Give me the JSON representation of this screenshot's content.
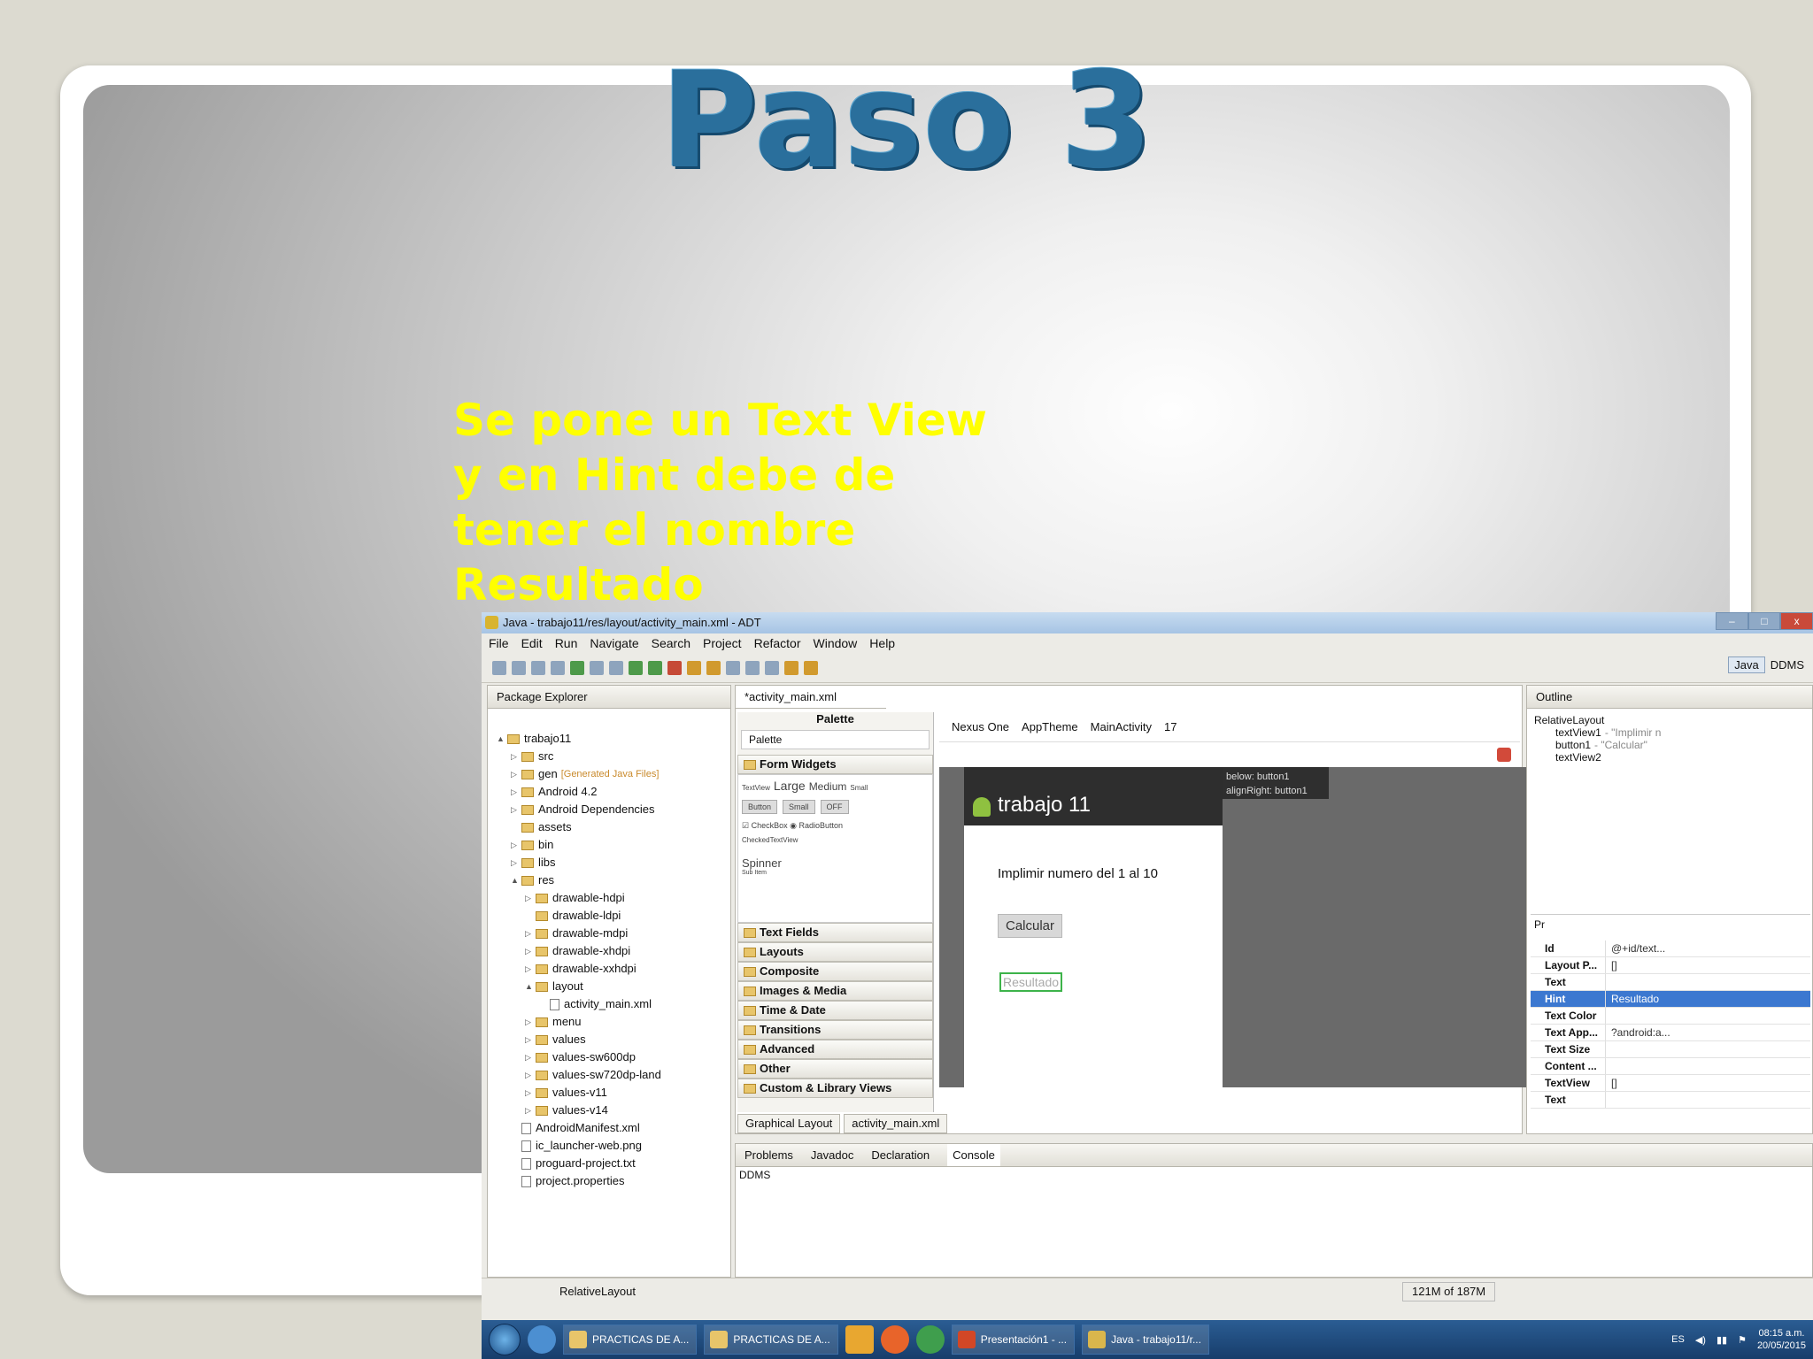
{
  "slide": {
    "title": "Paso 3",
    "body_lines": [
      "Se pone un Text View",
      "y en Hint debe de",
      "tener el nombre",
      "Resultado"
    ]
  },
  "window": {
    "title": "Java - trabajo11/res/layout/activity_main.xml - ADT",
    "minimize": "–",
    "maximize": "□",
    "close": "x"
  },
  "menu": [
    "File",
    "Edit",
    "Run",
    "Navigate",
    "Search",
    "Project",
    "Refactor",
    "Window",
    "Help"
  ],
  "perspectives": {
    "java": "Java",
    "ddms": "DDMS"
  },
  "package_explorer": {
    "tab": "Package Explorer",
    "tree": [
      {
        "label": "trabajo11",
        "depth": 0,
        "twisty": "▲",
        "icon": "project"
      },
      {
        "label": "src",
        "depth": 1,
        "twisty": "▷",
        "icon": "folder"
      },
      {
        "label": "gen",
        "note": "[Generated Java Files]",
        "depth": 1,
        "twisty": "▷",
        "icon": "folder"
      },
      {
        "label": "Android 4.2",
        "depth": 1,
        "twisty": "▷",
        "icon": "library"
      },
      {
        "label": "Android Dependencies",
        "depth": 1,
        "twisty": "▷",
        "icon": "library"
      },
      {
        "label": "assets",
        "depth": 1,
        "twisty": "",
        "icon": "folder"
      },
      {
        "label": "bin",
        "depth": 1,
        "twisty": "▷",
        "icon": "folder"
      },
      {
        "label": "libs",
        "depth": 1,
        "twisty": "▷",
        "icon": "folder"
      },
      {
        "label": "res",
        "depth": 1,
        "twisty": "▲",
        "icon": "folder"
      },
      {
        "label": "drawable-hdpi",
        "depth": 2,
        "twisty": "▷",
        "icon": "folder"
      },
      {
        "label": "drawable-ldpi",
        "depth": 2,
        "twisty": "",
        "icon": "folder"
      },
      {
        "label": "drawable-mdpi",
        "depth": 2,
        "twisty": "▷",
        "icon": "folder"
      },
      {
        "label": "drawable-xhdpi",
        "depth": 2,
        "twisty": "▷",
        "icon": "folder"
      },
      {
        "label": "drawable-xxhdpi",
        "depth": 2,
        "twisty": "▷",
        "icon": "folder"
      },
      {
        "label": "layout",
        "depth": 2,
        "twisty": "▲",
        "icon": "folder"
      },
      {
        "label": "activity_main.xml",
        "depth": 3,
        "twisty": "",
        "icon": "file"
      },
      {
        "label": "menu",
        "depth": 2,
        "twisty": "▷",
        "icon": "folder"
      },
      {
        "label": "values",
        "depth": 2,
        "twisty": "▷",
        "icon": "folder"
      },
      {
        "label": "values-sw600dp",
        "depth": 2,
        "twisty": "▷",
        "icon": "folder"
      },
      {
        "label": "values-sw720dp-land",
        "depth": 2,
        "twisty": "▷",
        "icon": "folder"
      },
      {
        "label": "values-v11",
        "depth": 2,
        "twisty": "▷",
        "icon": "folder"
      },
      {
        "label": "values-v14",
        "depth": 2,
        "twisty": "▷",
        "icon": "folder"
      },
      {
        "label": "AndroidManifest.xml",
        "depth": 1,
        "twisty": "",
        "icon": "file"
      },
      {
        "label": "ic_launcher-web.png",
        "depth": 1,
        "twisty": "",
        "icon": "file"
      },
      {
        "label": "proguard-project.txt",
        "depth": 1,
        "twisty": "",
        "icon": "file"
      },
      {
        "label": "project.properties",
        "depth": 1,
        "twisty": "",
        "icon": "file"
      }
    ]
  },
  "editor": {
    "tab": "*activity_main.xml",
    "palette_title": "Palette",
    "palette_dropdown": "Palette",
    "form_widgets": "Form Widgets",
    "widget_row1": {
      "prefix": "TextView",
      "large": "Large",
      "medium": "Medium",
      "small": "Small"
    },
    "widget_buttons": [
      "Button",
      "Small",
      "OFF"
    ],
    "checkbox_row": "☑ CheckBox  ◉ RadioButton",
    "checked_text": "CheckedTextView",
    "spinner": "Spinner",
    "spinner_sub": "Sub Item",
    "categories": [
      "Text Fields",
      "Layouts",
      "Composite",
      "Images & Media",
      "Time & Date",
      "Transitions",
      "Advanced",
      "Other",
      "Custom & Library Views"
    ],
    "config": {
      "device": "Nexus One",
      "theme": "AppTheme",
      "activity": "MainActivity",
      "api": "17"
    },
    "device_app_title": "trabajo 11",
    "device_text": "Implimir numero del 1 al 10",
    "device_button": "Calcular",
    "device_hint": "Resultado",
    "tooltip": [
      "below: button1",
      "alignRight: button1"
    ],
    "bottom_tabs": [
      "Graphical Layout",
      "activity_main.xml"
    ]
  },
  "console": {
    "tabs": [
      "Problems",
      "Javadoc",
      "Declaration",
      "Console"
    ],
    "content": "DDMS"
  },
  "outline": {
    "tab": "Outline",
    "root": "RelativeLayout",
    "children": [
      {
        "label": "textView1",
        "detail": "- \"Implimir n"
      },
      {
        "label": "button1",
        "detail": "- \"Calcular\""
      },
      {
        "label": "textView2",
        "detail": ""
      }
    ]
  },
  "properties": {
    "toolbar_label": "Pr",
    "rows": [
      {
        "key": "Id",
        "value": "@+id/text..."
      },
      {
        "key": "Layout P...",
        "value": "[]"
      },
      {
        "key": "Text",
        "value": ""
      },
      {
        "key": "Hint",
        "value": "Resultado",
        "selected": true
      },
      {
        "key": "Text Color",
        "value": ""
      },
      {
        "key": "Text App...",
        "value": "?android:a..."
      },
      {
        "key": "Text Size",
        "value": ""
      },
      {
        "key": "Content ...",
        "value": ""
      },
      {
        "key": "TextView",
        "value": "[]"
      },
      {
        "key": "Text",
        "value": ""
      }
    ]
  },
  "status": {
    "layout": "RelativeLayout",
    "memory": "121M of 187M"
  },
  "taskbar": {
    "items": [
      "PRACTICAS DE A...",
      "PRACTICAS DE A...",
      "Presentación1 - ...",
      "Java - trabajo11/r..."
    ],
    "language": "ES",
    "time": "08:15 a.m.",
    "date": "20/05/2015"
  }
}
